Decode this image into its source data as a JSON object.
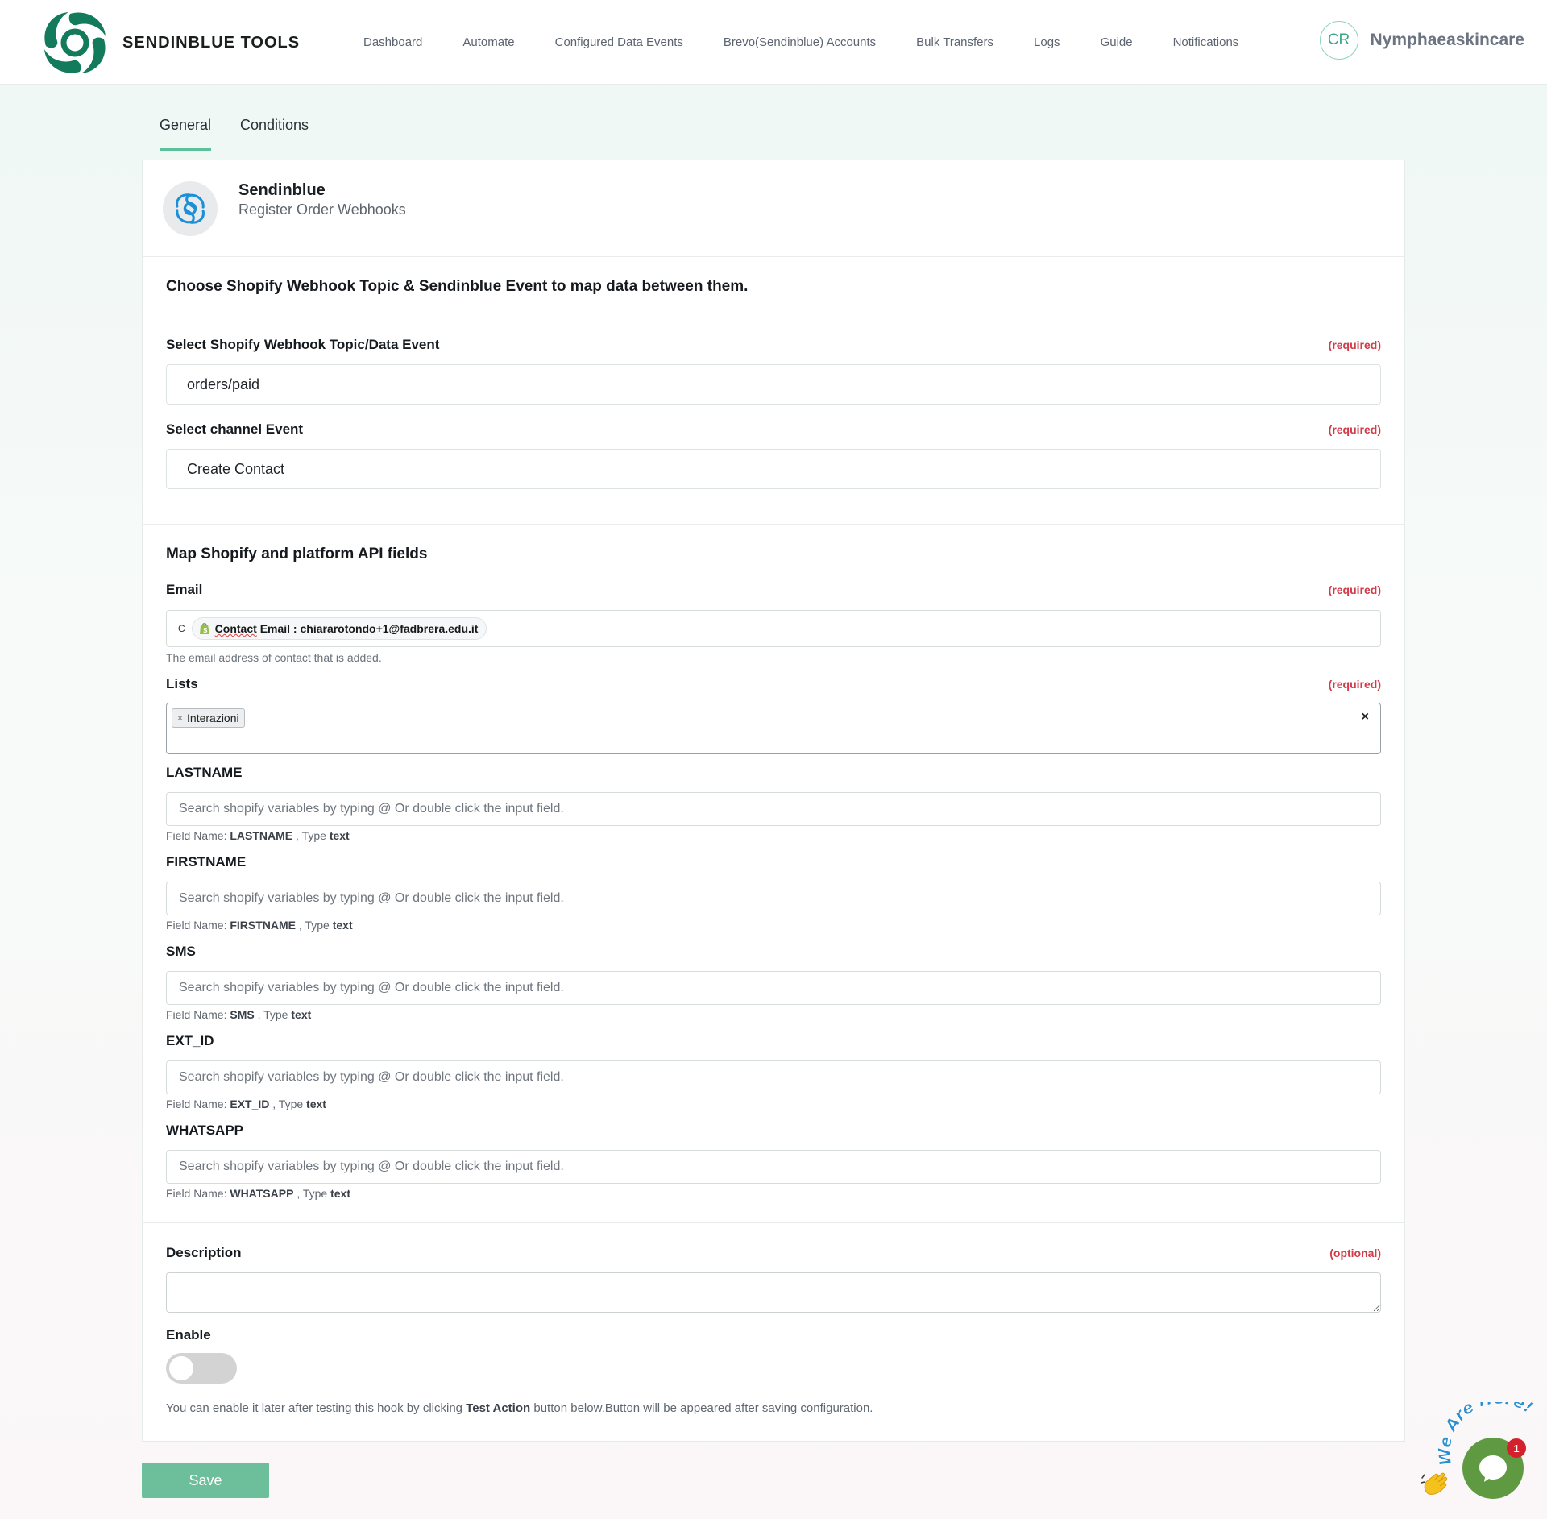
{
  "header": {
    "brand": "SENDINBLUE TOOLS",
    "nav": [
      "Dashboard",
      "Automate",
      "Configured Data Events",
      "Brevo(Sendinblue) Accounts",
      "Bulk Transfers",
      "Logs",
      "Guide",
      "Notifications"
    ],
    "user_initials": "CR",
    "user_name": "Nymphaeaskincare"
  },
  "tabs": [
    "General",
    "Conditions"
  ],
  "app": {
    "title": "Sendinblue",
    "subtitle": "Register Order Webhooks"
  },
  "webhook_section": {
    "title": "Choose Shopify Webhook Topic & Sendinblue Event to map data between them.",
    "topic_label": "Select Shopify Webhook Topic/Data Event",
    "topic_required": "(required)",
    "topic_value": "orders/paid",
    "event_label": "Select channel Event",
    "event_required": "(required)",
    "event_value": "Create Contact"
  },
  "mapping": {
    "title": "Map Shopify and platform API fields",
    "email": {
      "label": "Email",
      "required": "(required)",
      "prefix": "C",
      "chip_key": "Contact",
      "chip_text": "Email : chiararotondo+1@fadbrera.edu.it",
      "help": "The email address of contact that is added."
    },
    "lists": {
      "label": "Lists",
      "required": "(required)",
      "tag_remove": "×",
      "tag": "Interazioni",
      "clear": "×"
    },
    "placeholder": "Search shopify variables by typing @ Or double click the input field.",
    "field_name_prefix": "Field Name:",
    "type_prefix": ", Type",
    "fields": [
      {
        "label": "LASTNAME",
        "name": "LASTNAME",
        "type": "text"
      },
      {
        "label": "FIRSTNAME",
        "name": "FIRSTNAME",
        "type": "text"
      },
      {
        "label": "SMS",
        "name": "SMS",
        "type": "text"
      },
      {
        "label": "EXT_ID",
        "name": "EXT_ID",
        "type": "text"
      },
      {
        "label": "WHATSAPP",
        "name": "WHATSAPP",
        "type": "text"
      }
    ]
  },
  "description": {
    "label": "Description",
    "optional": "(optional)"
  },
  "enable": {
    "label": "Enable",
    "state": "off",
    "note_before": "You can enable it later after testing this hook by clicking",
    "note_bold": "Test Action",
    "note_after": "button below.Button will be appeared after saving configuration."
  },
  "save_label": "Save",
  "chat": {
    "text": "We Are Here!",
    "badge": "1"
  },
  "colors": {
    "brand_green": "#137a5b",
    "accent": "#5cc09b",
    "required_red": "#d23b49",
    "save_button": "#6cbf9a",
    "chat_green": "#5f9a42"
  }
}
